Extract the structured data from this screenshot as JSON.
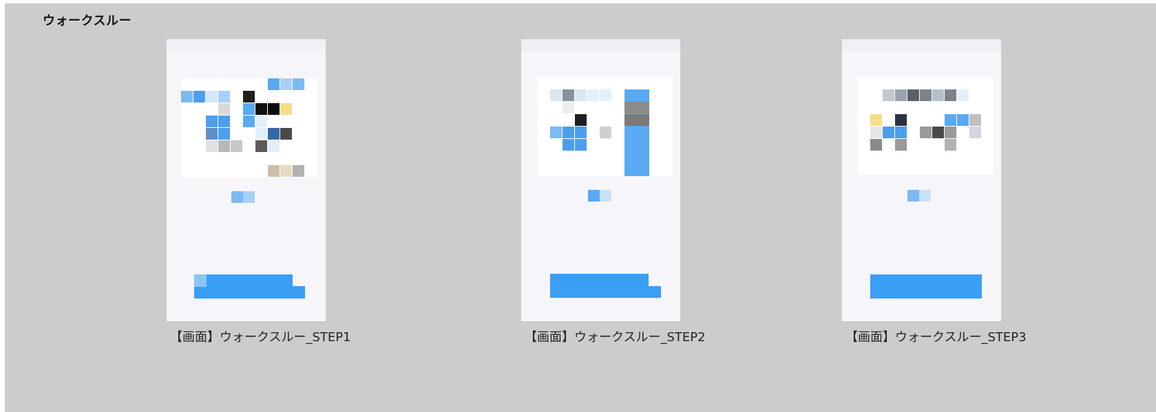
{
  "section": {
    "title": "ウォークスルー"
  },
  "screens": [
    {
      "caption": "【画面】ウォークスルー_STEP1"
    },
    {
      "caption": "【画面】ウォークスルー_STEP2"
    },
    {
      "caption": "【画面】ウォークスルー_STEP3"
    }
  ],
  "colors": {
    "canvas_bg": "#cccccc",
    "screen_bg": "#f6f6fa",
    "accent_blue": "#3a9ef5"
  }
}
